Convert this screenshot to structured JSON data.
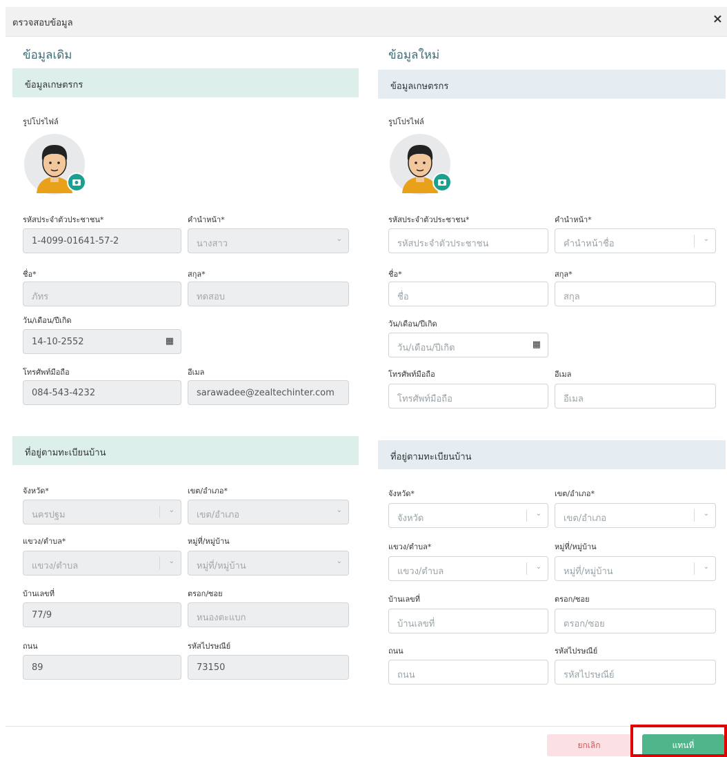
{
  "modal": {
    "title": "ตรวจสอบข้อมูล",
    "close_icon": "×"
  },
  "old": {
    "column_title": "ข้อมูลเดิม",
    "farmer_section": "ข้อมูลเกษตรกร",
    "profile_label": "รูปโปรไฟล์",
    "citizen_id": {
      "label": "รหัสประจำตัวประชาชน*",
      "value": "1-4099-01641-57-2"
    },
    "prefix": {
      "label": "คำนำหน้า*",
      "value": "นางสาว"
    },
    "first_name": {
      "label": "ชื่อ*",
      "value": "ภัทร"
    },
    "last_name": {
      "label": "สกุล*",
      "value": "ทดสอบ"
    },
    "birthdate": {
      "label": "วัน/เดือน/ปีเกิด",
      "value": "14-10-2552"
    },
    "mobile": {
      "label": "โทรศัพท์มือถือ",
      "value": "084-543-4232"
    },
    "email": {
      "label": "อีเมล",
      "value": "sarawadee@zealtechinter.com"
    },
    "address_section": "ที่อยู่ตามทะเบียนบ้าน",
    "province": {
      "label": "จังหวัด*",
      "value": "นครปฐม"
    },
    "district": {
      "label": "เขต/อำเภอ*",
      "value": "เขต/อำเภอ"
    },
    "subdistrict": {
      "label": "แขวง/ตำบล*",
      "value": "แขวง/ตำบล"
    },
    "village": {
      "label": "หมู่ที่/หมู่บ้าน",
      "value": "หมู่ที่/หมู่บ้าน"
    },
    "house_no": {
      "label": "บ้านเลขที่",
      "value": "77/9"
    },
    "alley": {
      "label": "ตรอก/ซอย",
      "value": "หนองตะแบก"
    },
    "road": {
      "label": "ถนน",
      "value": "89"
    },
    "postcode": {
      "label": "รหัสไปรษณีย์",
      "value": "73150"
    }
  },
  "new": {
    "column_title": "ข้อมูลใหม่",
    "farmer_section": "ข้อมูลเกษตรกร",
    "profile_label": "รูปโปรไฟล์",
    "citizen_id": {
      "label": "รหัสประจำตัวประชาชน*",
      "placeholder": "รหัสประจำตัวประชาชน"
    },
    "prefix": {
      "label": "คำนำหน้า*",
      "placeholder": "คำนำหน้าชื่อ"
    },
    "first_name": {
      "label": "ชื่อ*",
      "placeholder": "ชื่อ"
    },
    "last_name": {
      "label": "สกุล*",
      "placeholder": "สกุล"
    },
    "birthdate": {
      "label": "วัน/เดือน/ปีเกิด",
      "placeholder": "วัน/เดือน/ปีเกิด"
    },
    "mobile": {
      "label": "โทรศัพท์มือถือ",
      "placeholder": "โทรศัพท์มือถือ"
    },
    "email": {
      "label": "อีเมล",
      "placeholder": "อีเมล"
    },
    "address_section": "ที่อยู่ตามทะเบียนบ้าน",
    "province": {
      "label": "จังหวัด*",
      "placeholder": "จังหวัด"
    },
    "district": {
      "label": "เขต/อำเภอ*",
      "placeholder": "เขต/อำเภอ"
    },
    "subdistrict": {
      "label": "แขวง/ตำบล*",
      "placeholder": "แขวง/ตำบล"
    },
    "village": {
      "label": "หมู่ที่/หมู่บ้าน",
      "placeholder": "หมู่ที่/หมู่บ้าน"
    },
    "house_no": {
      "label": "บ้านเลขที่",
      "placeholder": "บ้านเลขที่"
    },
    "alley": {
      "label": "ตรอก/ซอย",
      "placeholder": "ตรอก/ซอย"
    },
    "road": {
      "label": "ถนน",
      "placeholder": "ถนน"
    },
    "postcode": {
      "label": "รหัสไปรษณีย์",
      "placeholder": "รหัสไปรษณีย์"
    }
  },
  "footer": {
    "cancel_label": "ยกเลิก",
    "replace_label": "แทนที่"
  },
  "icons": {
    "calendar": "calendar-icon",
    "chevron": "chevron-down-icon",
    "camera": "camera-icon",
    "avatar": "user-avatar"
  },
  "colors": {
    "accent": "#4fb58b",
    "cancel": "#d9534f",
    "highlight": "#e00000"
  }
}
